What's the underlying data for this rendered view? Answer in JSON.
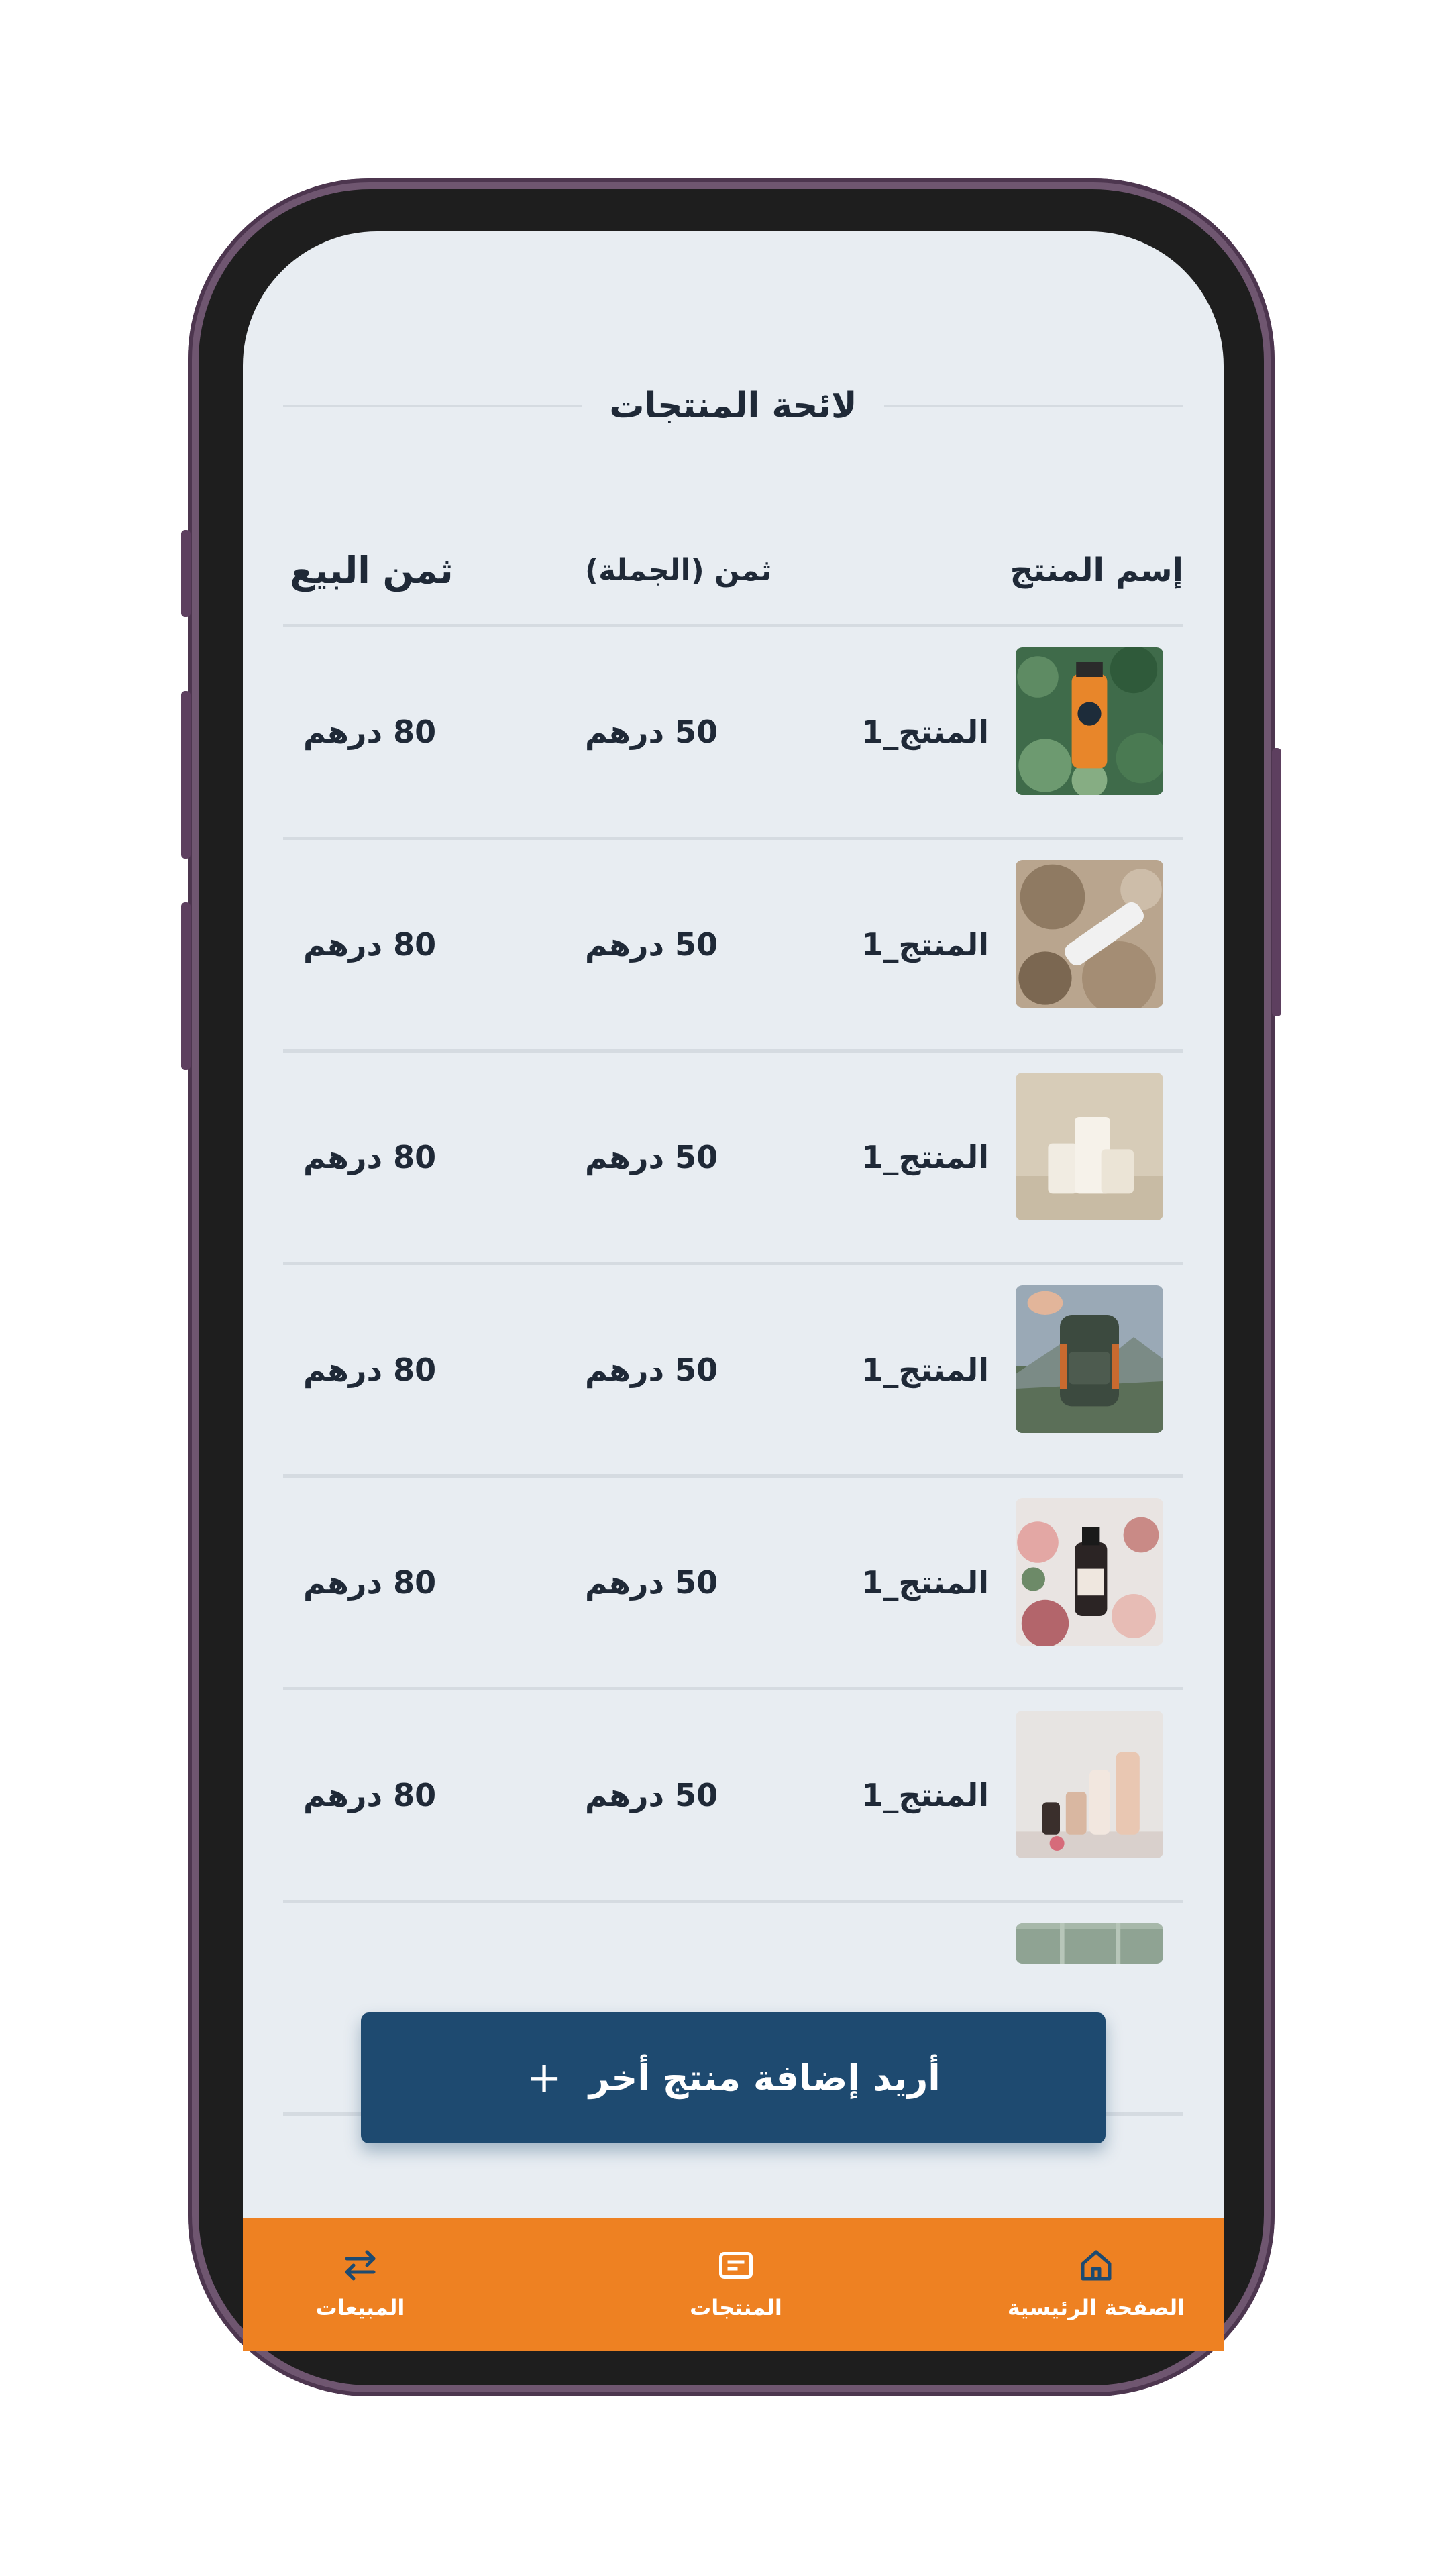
{
  "page": {
    "title": "لائحة المنتجات"
  },
  "table": {
    "headers": {
      "name": "إسم المنتج",
      "wholesale": "ثمن (الجملة)",
      "sale": "ثمن البيع"
    },
    "rows": [
      {
        "name": "المنتج_1",
        "wholesale": "50 درهم",
        "sale": "80 درهم",
        "image": "orange-bottle-leaves"
      },
      {
        "name": "المنتج_1",
        "wholesale": "50 درهم",
        "sale": "80 درهم",
        "image": "white-tube-on-fur"
      },
      {
        "name": "المنتج_1",
        "wholesale": "50 درهم",
        "sale": "80 درهم",
        "image": "white-cylinders"
      },
      {
        "name": "المنتج_1",
        "wholesale": "50 درهم",
        "sale": "80 درهم",
        "image": "backpack-mountains"
      },
      {
        "name": "المنتج_1",
        "wholesale": "50 درهم",
        "sale": "80 درهم",
        "image": "bottle-flowers"
      },
      {
        "name": "المنتج_1",
        "wholesale": "50 درهم",
        "sale": "80 درهم",
        "image": "cosmetics-set"
      }
    ]
  },
  "add_button": {
    "label": "أريد إضافة منتج أخر",
    "icon": "+"
  },
  "bottom_nav": {
    "home": {
      "label": "الصفحة الرئيسية",
      "icon": "home-icon"
    },
    "products": {
      "label": "المنتجات",
      "icon": "list-icon"
    },
    "sales": {
      "label": "المبيعات",
      "icon": "swap-arrows-icon"
    }
  },
  "colors": {
    "screen_bg": "#e8edf2",
    "primary": "#1e4a70",
    "nav_bg": "#ee8122",
    "frame": "#6f5670"
  }
}
